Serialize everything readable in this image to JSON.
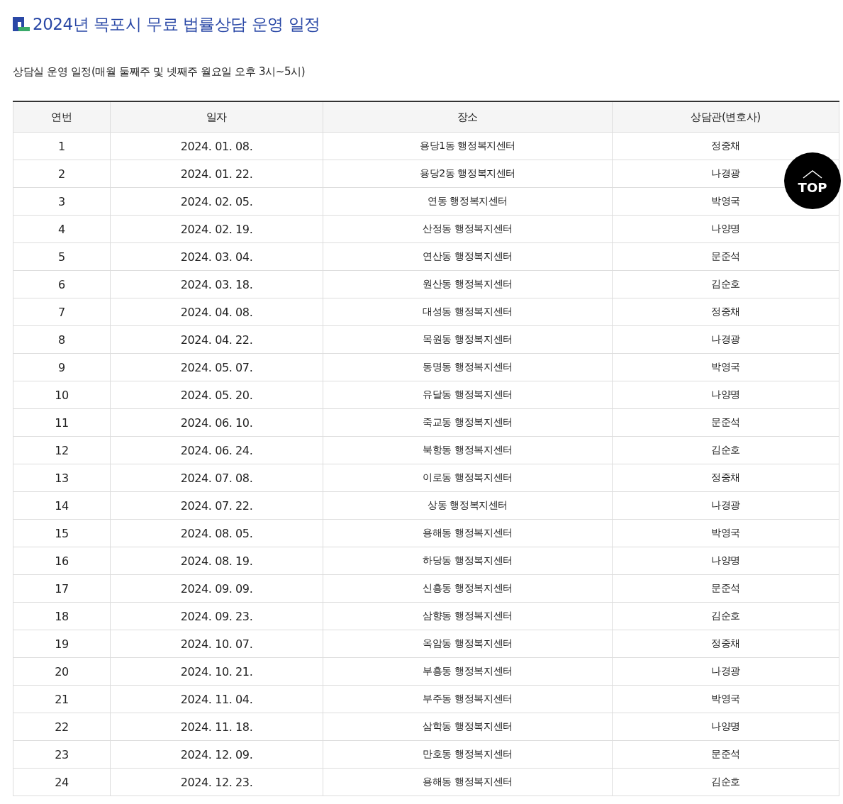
{
  "title": "2024년 목포시 무료 법률상담 운영 일정",
  "subtitle": "상담실 운영 일정(매월 둘째주 및 넷째주 월요일 오후 3시~5시)",
  "table": {
    "columns": [
      "연번",
      "일자",
      "장소",
      "상담관(변호사)"
    ],
    "rows": [
      [
        "1",
        "2024. 01. 08.",
        "용당1동 행정복지센터",
        "정중채"
      ],
      [
        "2",
        "2024. 01. 22.",
        "용당2동 행정복지센터",
        "나경광"
      ],
      [
        "3",
        "2024. 02. 05.",
        "연동 행정복지센터",
        "박영국"
      ],
      [
        "4",
        "2024. 02. 19.",
        "산정동 행정복지센터",
        "나양명"
      ],
      [
        "5",
        "2024. 03. 04.",
        "연산동 행정복지센터",
        "문준석"
      ],
      [
        "6",
        "2024. 03. 18.",
        "원산동 행정복지센터",
        "김순호"
      ],
      [
        "7",
        "2024. 04. 08.",
        "대성동 행정복지센터",
        "정중채"
      ],
      [
        "8",
        "2024. 04. 22.",
        "목원동 행정복지센터",
        "나경광"
      ],
      [
        "9",
        "2024. 05. 07.",
        "동명동 행정복지센터",
        "박영국"
      ],
      [
        "10",
        "2024. 05. 20.",
        "유달동 행정복지센터",
        "나양명"
      ],
      [
        "11",
        "2024. 06. 10.",
        "죽교동 행정복지센터",
        "문준석"
      ],
      [
        "12",
        "2024. 06. 24.",
        "북항동 행정복지센터",
        "김순호"
      ],
      [
        "13",
        "2024. 07. 08.",
        "이로동 행정복지센터",
        "정중채"
      ],
      [
        "14",
        "2024. 07. 22.",
        "상동 행정복지센터",
        "나경광"
      ],
      [
        "15",
        "2024. 08. 05.",
        "용해동 행정복지센터",
        "박영국"
      ],
      [
        "16",
        "2024. 08. 19.",
        "하당동 행정복지센터",
        "나양명"
      ],
      [
        "17",
        "2024. 09. 09.",
        "신흥동 행정복지센터",
        "문준석"
      ],
      [
        "18",
        "2024. 09. 23.",
        "삼향동 행정복지센터",
        "김순호"
      ],
      [
        "19",
        "2024. 10. 07.",
        "옥암동 행정복지센터",
        "정중채"
      ],
      [
        "20",
        "2024. 10. 21.",
        "부흥동 행정복지센터",
        "나경광"
      ],
      [
        "21",
        "2024. 11. 04.",
        "부주동 행정복지센터",
        "박영국"
      ],
      [
        "22",
        "2024. 11. 18.",
        "삼학동 행정복지센터",
        "나양명"
      ],
      [
        "23",
        "2024. 12. 09.",
        "만호동 행정복지센터",
        "문준석"
      ],
      [
        "24",
        "2024. 12. 23.",
        "용해동 행정복지센터",
        "김순호"
      ]
    ]
  },
  "top_button": "TOP"
}
